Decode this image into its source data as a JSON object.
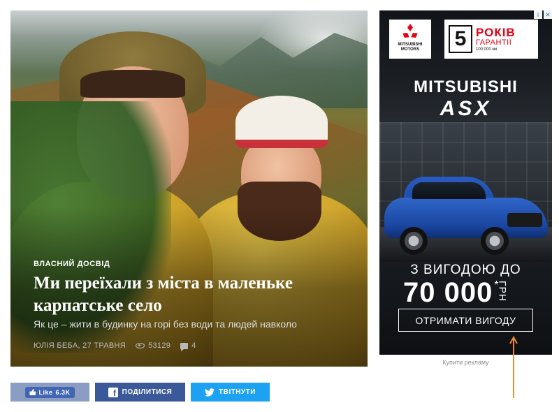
{
  "article": {
    "kicker": "ВЛАСНИЙ ДОСВІД",
    "title": "Ми переїхали з міста в маленьке карпатське село",
    "subtitle": "Як це – жити в будинку на горі без води та людей навколо",
    "author_date": "ЮЛІЯ БЕБА, 27 ТРАВНЯ",
    "views": "53129",
    "comments": "4"
  },
  "ad": {
    "choices_info": "i",
    "choices_close": "✕",
    "logo_text": "MITSUBISHI MOTORS",
    "warranty_years": "5",
    "warranty_word": "РОКІВ",
    "warranty_label": "ГАРАНТІЇ",
    "warranty_km": "100 000 км",
    "brand": "MITSUBISHI",
    "model": "ASX",
    "offer": "З ВИГОДОЮ ДО",
    "amount": "70 000",
    "amount_mark": "*",
    "currency": "ГРН",
    "cta": "ОТРИМАТИ ВИГОДУ",
    "buy_ads": "Купити рекламу"
  },
  "share": {
    "like_label": "Like",
    "like_count": "6.3K",
    "facebook_label": "ПОДІЛИТИСЯ",
    "twitter_label": "ТВІТНУТИ"
  },
  "colors": {
    "facebook": "#3b5998",
    "facebook_like": "#8b9dc3",
    "twitter": "#1da1f2",
    "annotation_arrow": "#f08a2c",
    "mitsubishi_red": "#e60012"
  },
  "icons": [
    "eye-icon",
    "comment-icon",
    "thumb-up-icon",
    "facebook-icon",
    "twitter-bird-icon",
    "ad-info-icon",
    "ad-close-icon",
    "annotation-arrow"
  ]
}
